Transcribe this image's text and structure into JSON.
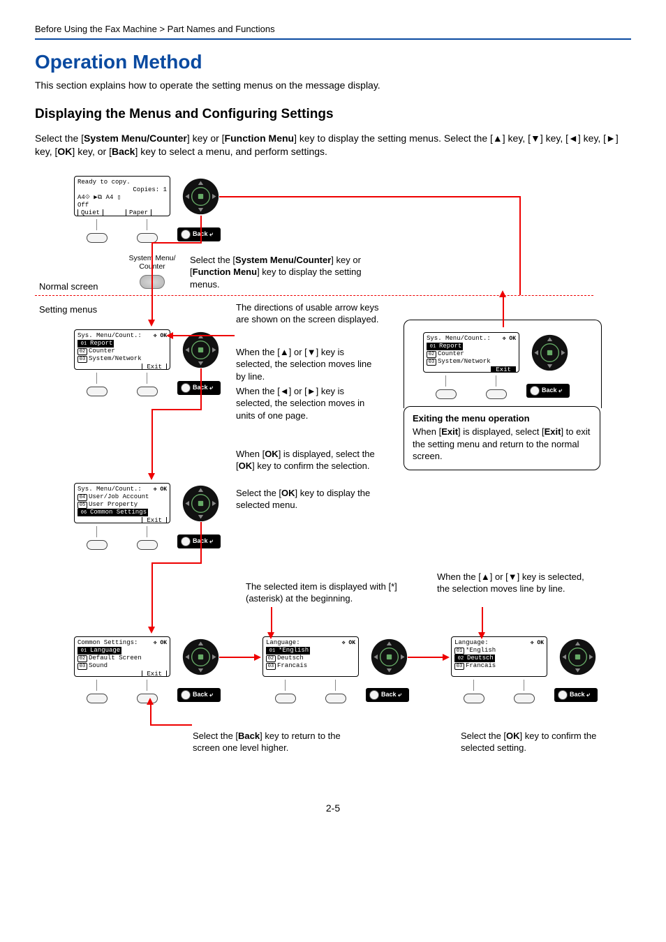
{
  "breadcrumb": "Before Using the Fax Machine > Part Names and Functions",
  "title": "Operation Method",
  "intro": "This section explains how to operate the setting menus on the message display.",
  "subtitle": "Displaying the Menus and Configuring Settings",
  "para_html": "Select the [<b>System Menu/Counter</b>] key or [<b>Function Menu</b>] key to display the setting menus. Select the [▲] key, [▼] key, [◄] key, [►] key, [<b>OK</b>] key, or [<b>Back</b>] key to select a menu, and perform settings.",
  "labels": {
    "normal_screen": "Normal screen",
    "setting_menus": "Setting menus",
    "sysmenu": "System Menu/\nCounter",
    "back": "Back"
  },
  "ann": {
    "a1_html": "Select the [<b>System Menu/Counter</b>] key or [<b>Function Menu</b>] key to display the setting menus.",
    "a2": "The directions of usable arrow keys are shown on the screen displayed.",
    "a3": "When the [▲] or [▼] key is selected, the selection moves line by line.",
    "a4": "When the [◄] or [►] key is selected, the selection moves in units of one page.",
    "a5_html": "When [<b>OK</b>] is displayed, select the [<b>OK</b>] key to confirm the selection.",
    "a6_html": "Select the [<b>OK</b>] key to display the selected menu.",
    "a7": "The selected item is displayed with [*] (asterisk) at the beginning.",
    "a8": "When the [▲] or [▼] key is selected, the selection moves line by line.",
    "a9_html": "Select the [<b>Back</b>] key to return to the screen one level higher.",
    "a10_html": "Select the [<b>OK</b>] key to confirm the selected setting."
  },
  "callout": {
    "title": "Exiting the menu operation",
    "body_html": "When [<b>Exit</b>] is displayed, select [<b>Exit</b>] to exit the setting menu and return to the normal screen."
  },
  "lcd": {
    "l1": {
      "l1": "Ready to copy.",
      "l2r": "Copies:    1",
      "l3": " A4⟐    ▶⧉  A4 ▯",
      "l4": "    Off",
      "b1": "Quiet",
      "b2": "Paper"
    },
    "l2": {
      "title": "Sys. Menu/Count.:",
      "r1": "01 Report",
      "r2": "02 Counter",
      "r3": "03 System/Network",
      "exit": "Exit"
    },
    "l3": {
      "title": "Sys. Menu/Count.:",
      "r1": "04 User/Job Account",
      "r2": "05 User Property",
      "r3": "06 Common Settings",
      "exit": "Exit"
    },
    "l4": {
      "title": "Common Settings:",
      "r1": "01 Language",
      "r2": "02 Default Screen",
      "r3": "03 Sound",
      "exit": "Exit"
    },
    "l5": {
      "title": "Language:",
      "r1": "01*English",
      "r2": "02 Deutsch",
      "r3": "03 Francais"
    },
    "l6": {
      "title": "Sys. Menu/Count.:",
      "r1": "01 Report",
      "r2": "02 Counter",
      "r3": "03 System/Network",
      "exit": "Exit"
    },
    "l7": {
      "title": "Language:",
      "r1": "01*English",
      "r2": "02 Deutsch",
      "r3": "03 Francais"
    }
  },
  "pagenum": "2-5"
}
